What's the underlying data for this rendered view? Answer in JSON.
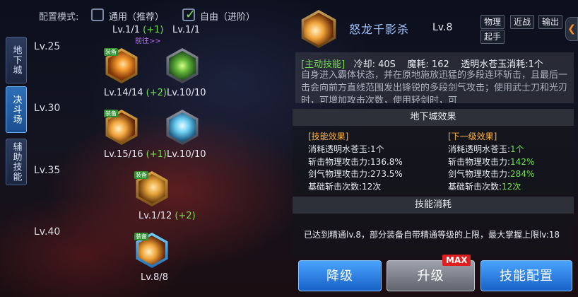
{
  "mode": {
    "label": "配置模式:",
    "option1": "通用（推荐）",
    "option2": "自由（进阶）",
    "checked": "option2"
  },
  "side_tabs": [
    {
      "label": "地下城"
    },
    {
      "label": "决斗场",
      "active": true
    },
    {
      "label": "辅助技能"
    }
  ],
  "level_labels": [
    "Lv.25",
    "Lv.30",
    "Lv.35",
    "Lv.40"
  ],
  "top_levels": {
    "a": "Lv.1/1",
    "a_bonus": "(+1)",
    "b": "Lv.1/1",
    "goto": "前往>>"
  },
  "skills": [
    {
      "level": "Lv.14/14",
      "bonus": "(+2)",
      "equip": "装备",
      "icon": "flame-strike-icon"
    },
    {
      "level": "Lv.10/10",
      "bonus": "",
      "icon": "green-blades-icon"
    },
    {
      "level": "Lv.15/16",
      "bonus": "(+1)",
      "equip": "装备",
      "icon": "crescent-slash-icon"
    },
    {
      "level": "Lv.10/10",
      "bonus": "",
      "icon": "ice-spikes-icon"
    },
    {
      "level": "Lv.1/12",
      "bonus": "(+2)",
      "equip": "装备",
      "icon": "beast-roar-icon"
    },
    {
      "level": "Lv.8/8",
      "bonus": "",
      "equip": "装备",
      "icon": "dragon-slash-icon",
      "selected": true
    }
  ],
  "detail": {
    "name": "怒龙千影杀",
    "level": "Lv.8",
    "tags": [
      "物理",
      "近战",
      "输出",
      "起手"
    ],
    "active_tag": "[主动技能]",
    "cooldown": "冷却: 40S",
    "mp": "魔耗: 162",
    "consume": "透明水苍玉消耗:1个",
    "description": "自身进入霸体状态，并在原地施放迅猛的多段连环斩击，且最后一击会向前方直线范围发出锋锐的多段剑气攻击；使用武士刀和光刃时，可增加攻击次数，使用轻剑时，可"
  },
  "dungeon_effect": {
    "title": "地下城效果",
    "current_head": "[技能效果]",
    "next_head": "[下一级效果]",
    "current": [
      {
        "label": "消耗透明水苍玉:",
        "value": "1个"
      },
      {
        "label": "斩击物理攻击力:",
        "value": "136.8%"
      },
      {
        "label": "剑气物理攻击力:",
        "value": "273.5%"
      },
      {
        "label": "基础斩击次数:",
        "value": "12次"
      }
    ],
    "next": [
      {
        "label": "消耗透明水苍玉:",
        "value": "1个"
      },
      {
        "label": "斩击物理攻击力:",
        "value": "142%"
      },
      {
        "label": "剑气物理攻击力:",
        "value": "284%"
      },
      {
        "label": "基础斩击次数:",
        "value": "12次"
      }
    ]
  },
  "skill_cost": {
    "title": "技能消耗",
    "text": "已达到精通lv.8，部分装备自带精通等级的上限，最大掌握上限lv:18"
  },
  "buttons": {
    "down": "降级",
    "up": "升级",
    "config": "技能配置",
    "max": "MAX"
  },
  "colors": {
    "accent_blue": "#2f7fe0",
    "bonus_green": "#6fe04a",
    "header_gold": "#ffb13b",
    "max_red": "#e01e1e"
  }
}
